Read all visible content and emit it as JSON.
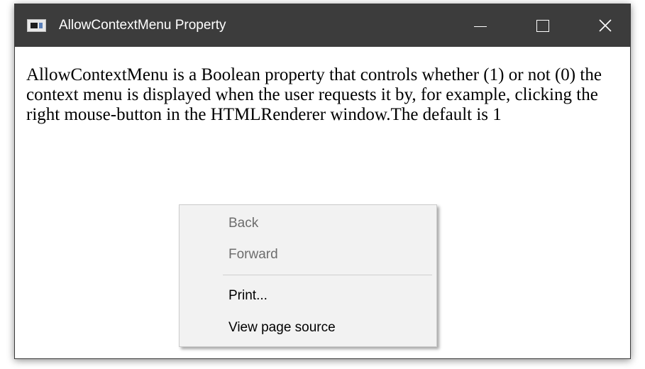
{
  "window": {
    "title": "AllowContextMenu Property",
    "icon": "app-window-icon",
    "controls": {
      "minimize_icon": "minimize-icon",
      "maximize_icon": "maximize-icon",
      "close_icon": "close-icon",
      "close_glyph": "✕"
    }
  },
  "content": {
    "paragraph": "AllowContextMenu is a Boolean property that controls whether (1) or not (0) the context menu is displayed when the user requests it by, for example, clicking the right mouse-button in the HTMLRenderer window.The default is 1"
  },
  "context_menu": {
    "items": [
      {
        "label": "Back",
        "enabled": false
      },
      {
        "label": "Forward",
        "enabled": false
      },
      {
        "label": "Print...",
        "enabled": true
      },
      {
        "label": "View page source",
        "enabled": true
      }
    ]
  },
  "colors": {
    "titlebar": "#3c3c3c",
    "menu_background": "#f2f2f2",
    "disabled_text": "#6d6d6d"
  }
}
